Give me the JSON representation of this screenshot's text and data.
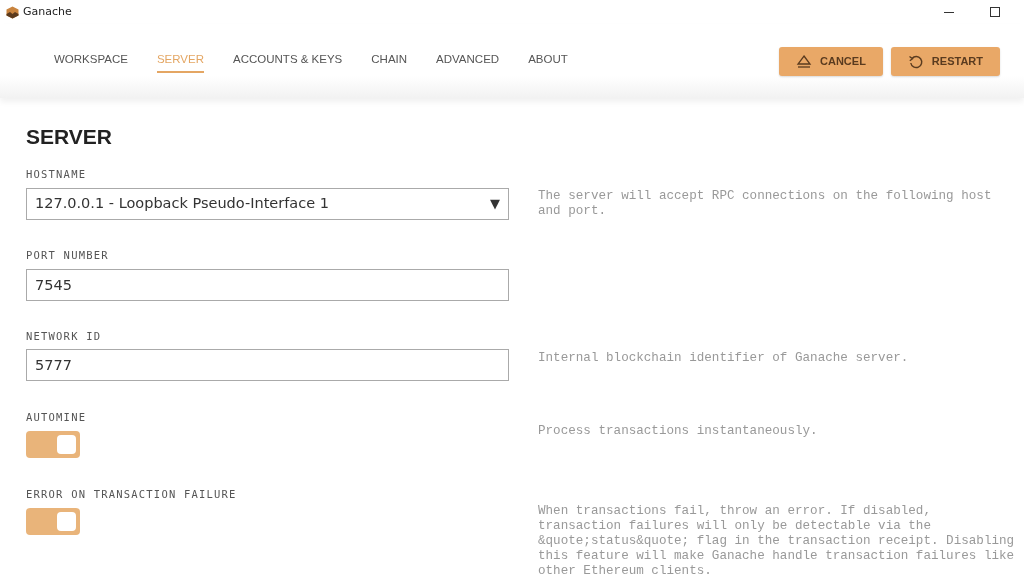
{
  "window": {
    "title": "Ganache"
  },
  "tabs": [
    {
      "label": "WORKSPACE",
      "selected": false
    },
    {
      "label": "SERVER",
      "selected": true
    },
    {
      "label": "ACCOUNTS & KEYS",
      "selected": false
    },
    {
      "label": "CHAIN",
      "selected": false
    },
    {
      "label": "ADVANCED",
      "selected": false
    },
    {
      "label": "ABOUT",
      "selected": false
    }
  ],
  "actions": [
    {
      "label": "CANCEL",
      "kind": "eject"
    },
    {
      "label": "RESTART",
      "kind": "restart"
    }
  ],
  "heading": "SERVER",
  "settings": [
    {
      "kind": "select",
      "label": "HOSTNAME",
      "value": "127.0.0.1 - Loopback Pseudo-Interface 1",
      "caret": "▼",
      "help": "The server will accept RPC connections on the following host and port."
    },
    {
      "kind": "text",
      "label": "PORT NUMBER",
      "value": "7545"
    },
    {
      "kind": "text",
      "label": "NETWORK ID",
      "value": "5777",
      "help": "Internal blockchain identifier of Ganache server."
    },
    {
      "kind": "toggle",
      "label": "AUTOMINE",
      "on": true,
      "help": "Process transactions instantaneously."
    },
    {
      "kind": "toggle",
      "label": "ERROR ON TRANSACTION FAILURE",
      "on": true,
      "help": "When transactions fail, throw an error. If disabled, transaction failures will only be detectable via the &quote;status&quote; flag in the transaction receipt. Disabling this feature will make Ganache handle transaction failures like other Ethereum clients."
    }
  ]
}
